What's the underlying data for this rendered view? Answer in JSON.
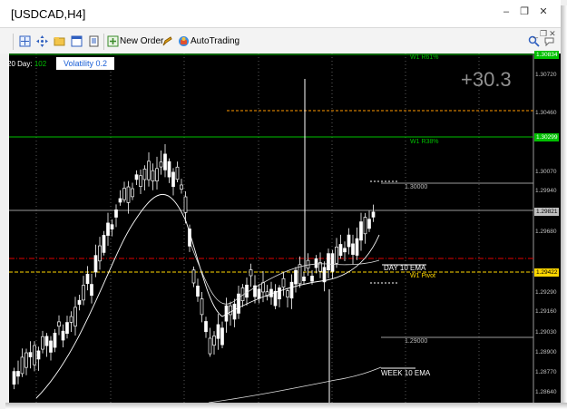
{
  "window": {
    "title": "[USDCAD,H4]"
  },
  "toolbar": {
    "new_order": "New Order",
    "autotrading": "AutoTrading"
  },
  "chart": {
    "symbol": "USDCAD",
    "timeframe": "H4",
    "day_prefix": "20 Day:",
    "day_value": "102",
    "volatility": "Volatility 0.2",
    "pips": "+30.3",
    "price_axis": [
      "1.30720",
      "1.30460",
      "1.30070",
      "1.29940",
      "1.29680",
      "1.29290",
      "1.29160",
      "1.29030",
      "1.28900",
      "1.28770",
      "1.28640"
    ],
    "price_boxes": [
      {
        "label": "1.30834",
        "color": "#00c000",
        "text_color": "#ffffff"
      },
      {
        "label": "1.30299",
        "color": "#00c000",
        "text_color": "#ffffff"
      },
      {
        "label": "1.29821",
        "color": "#c0c0c0",
        "text_color": "#000000"
      },
      {
        "label": "1.29422",
        "color": "#ffd700",
        "text_color": "#000000"
      }
    ],
    "levels": {
      "w1_r61": "W1 R61%",
      "w1_r38": "W1 R38%",
      "w1_pivot": "W1 Pivot",
      "round_high": "1.30000",
      "round_low": "1.29000",
      "day_ema": "DAY 10 EMA",
      "week_ema": "WEEK 10 EMA"
    },
    "colors": {
      "background": "#000000",
      "grid": "#5a5a5a",
      "fib_line": "#00c000",
      "pivot_line": "#ffd700",
      "red_line": "#e00000",
      "orange_line": "#ff9900",
      "candle": "#ffffff"
    }
  }
}
